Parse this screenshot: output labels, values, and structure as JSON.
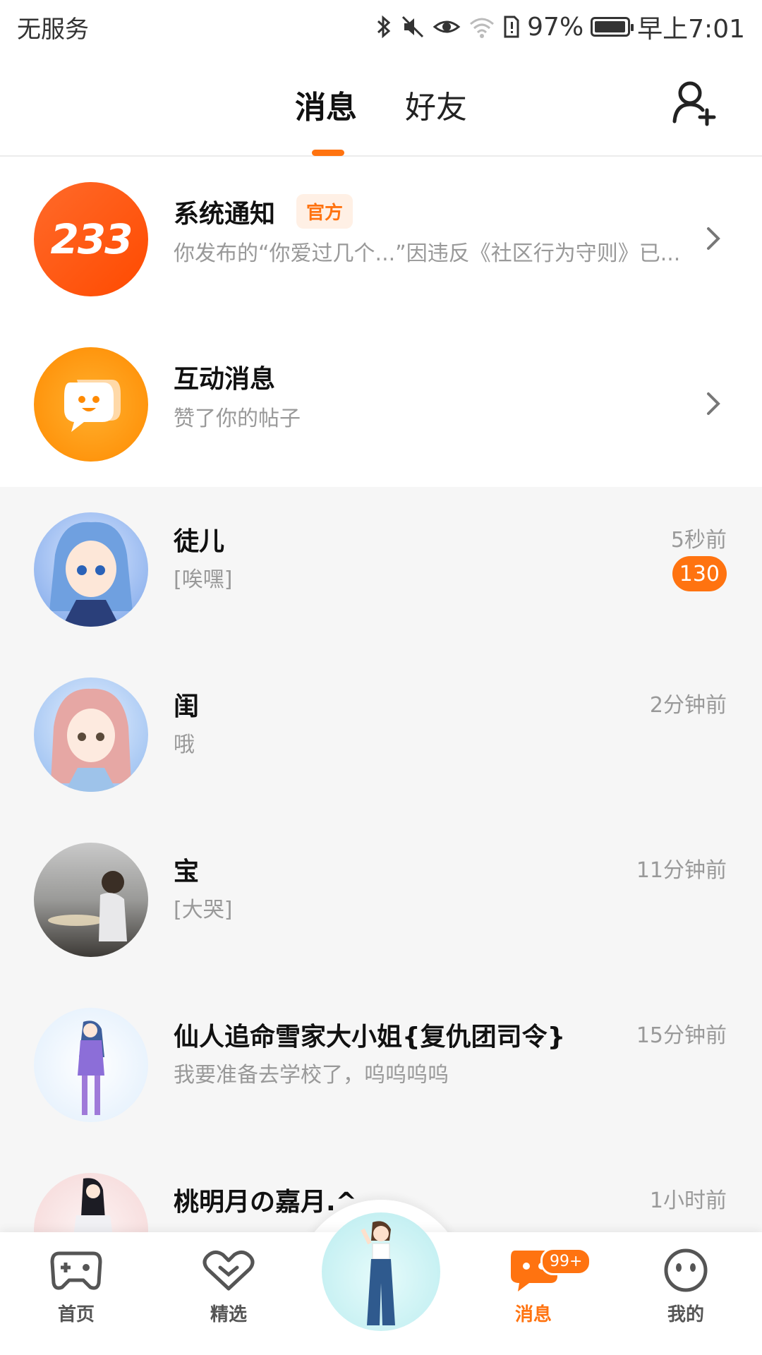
{
  "status_bar": {
    "carrier": "无服务",
    "battery": "97%",
    "battery_level": 0.97,
    "time": "早上7:01"
  },
  "header": {
    "tabs": [
      {
        "label": "消息",
        "active": true
      },
      {
        "label": "好友",
        "active": false
      }
    ],
    "add_friend_icon": "add-person-icon"
  },
  "system_items": [
    {
      "title": "系统通知",
      "badge": "官方",
      "subtitle": "你发布的“你爱过几个...”因违反《社区行为守则》已...",
      "avatar_text": "233"
    },
    {
      "title": "互动消息",
      "subtitle": "赞了你的帖子"
    }
  ],
  "chats": [
    {
      "name": "徒儿",
      "message": "[唉嘿]",
      "time": "5秒前",
      "unread": "130"
    },
    {
      "name": "闺",
      "message": "哦",
      "time": "2分钟前"
    },
    {
      "name": "宝",
      "message": "[大哭]",
      "time": "11分钟前"
    },
    {
      "name": "仙人追命雪家大小姐{复仇团司令}",
      "message": "我要准备去学校了，呜呜呜呜",
      "time": "15分钟前"
    },
    {
      "name": "桃明月の嘉月.^",
      "message": "",
      "time": "1小时前"
    }
  ],
  "bottom_nav": {
    "items": [
      {
        "label": "首页",
        "icon": "gamepad-icon"
      },
      {
        "label": "精选",
        "icon": "heart-chevron-icon"
      },
      {
        "label": "消息",
        "icon": "chat-bubble-icon",
        "active": true,
        "badge": "99+"
      },
      {
        "label": "我的",
        "icon": "face-icon"
      }
    ]
  },
  "colors": {
    "accent": "#ff7310",
    "muted_text": "#999999",
    "list_bg": "#f6f6f6"
  }
}
